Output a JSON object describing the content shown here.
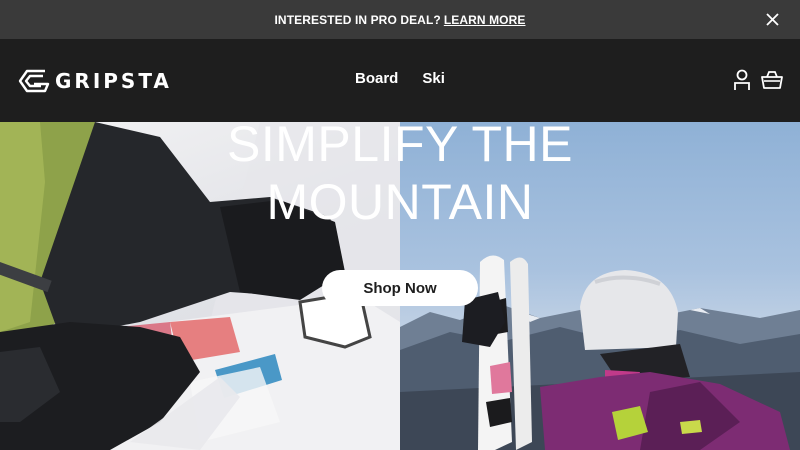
{
  "announcement": {
    "message": "INTERESTED IN PRO DEAL?",
    "link_label": "LEARN MORE",
    "close_icon": "close-icon"
  },
  "header": {
    "brand": "GRIPSTA",
    "nav": [
      {
        "label": "Board"
      },
      {
        "label": "Ski"
      }
    ],
    "icons": [
      "account-icon",
      "cart-icon"
    ]
  },
  "hero": {
    "title_line1": "SIMPLIFY THE",
    "title_line2": "MOUNTAIN",
    "cta_label": "Shop Now",
    "images": [
      "snowboarder-image",
      "skier-image"
    ]
  },
  "colors": {
    "announcement_bg": "#3a3a3a",
    "header_bg": "#1e1e1e",
    "text": "#ffffff",
    "button_bg": "#ffffff"
  }
}
